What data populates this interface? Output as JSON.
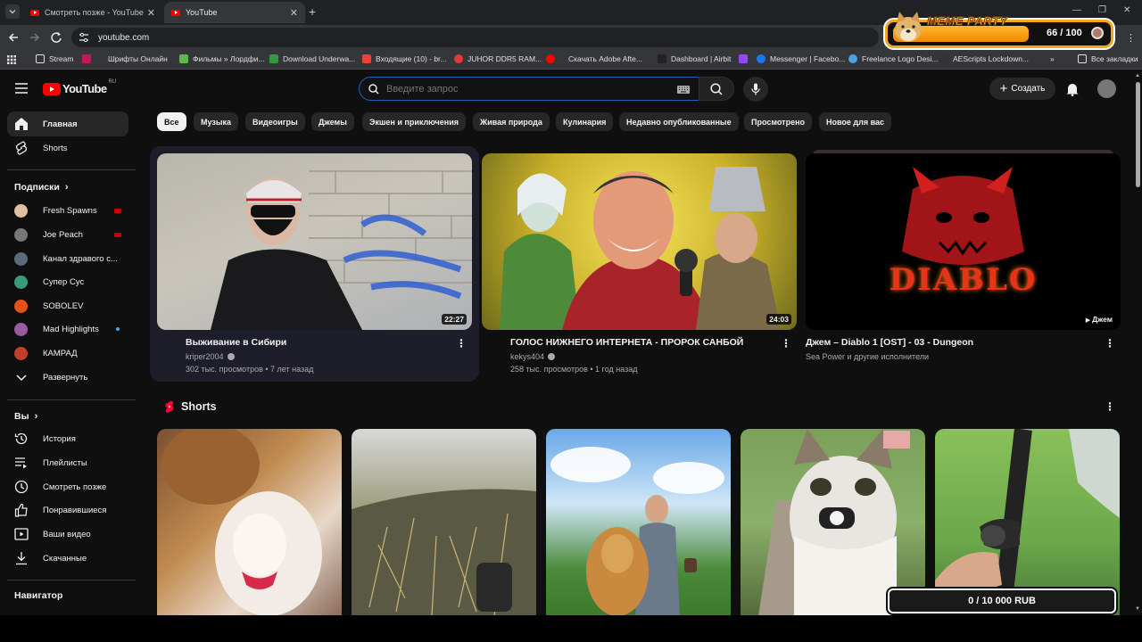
{
  "browser": {
    "tabs": [
      {
        "label": "Смотреть позже - YouTube",
        "active": false
      },
      {
        "label": "YouTube",
        "active": true
      }
    ],
    "address": "youtube.com",
    "bookmarks": [
      {
        "label": "Stream",
        "color": "#8ab4f8"
      },
      {
        "label": "Шрифты Онлайн",
        "color": "#e05a5a"
      },
      {
        "label": "Фильмы » Лордфи...",
        "color": "#59b94a"
      },
      {
        "label": "Download Underwa...",
        "color": "#2e9b3c"
      },
      {
        "label": "Входящие (10) - br...",
        "color": "#ea4335"
      },
      {
        "label": "JUHOR DDR5 RAM...",
        "color": "#e53935"
      },
      {
        "label": "Скачать Adobe Afte...",
        "color": "#ff0000"
      },
      {
        "label": "Dashboard | Airbit",
        "color": "#222222"
      },
      {
        "label": "Messenger | Facebo...",
        "color": "#1877f2"
      },
      {
        "label": "Freelance Logo Desi...",
        "color": "#4aa3df"
      },
      {
        "label": "AEScripts Lockdown...",
        "color": "#333333"
      }
    ],
    "all_bookmarks": "Все закладки"
  },
  "meme_overlay": {
    "title": "MEME PARTY",
    "count": "66 / 100"
  },
  "donation_overlay": {
    "text": "0 / 10 000 RUB"
  },
  "header": {
    "logo": "YouTube",
    "region": "RU",
    "search_placeholder": "Введите запрос",
    "create_label": "Создать"
  },
  "sidebar": {
    "main": [
      {
        "label": "Главная",
        "icon": "home-icon",
        "active": true
      },
      {
        "label": "Shorts",
        "icon": "shorts-icon",
        "active": false
      }
    ],
    "subscriptions_title": "Подписки",
    "subscriptions": [
      {
        "label": "Fresh Spawns",
        "avatar_color": "#e0c0a0",
        "badge": "live"
      },
      {
        "label": "Joe Peach",
        "avatar_color": "#777777",
        "badge": "live"
      },
      {
        "label": "Канал здравого с...",
        "avatar_color": "#5a6a7a",
        "badge": ""
      },
      {
        "label": "Супер Сус",
        "avatar_color": "#3a9a7a",
        "badge": ""
      },
      {
        "label": "SOBOLEV",
        "avatar_color": "#e8501a",
        "badge": ""
      },
      {
        "label": "Mad Highlights",
        "avatar_color": "#9a5aa0",
        "badge": "new"
      },
      {
        "label": "КАМРАД",
        "avatar_color": "#c0402a",
        "badge": ""
      }
    ],
    "expand_label": "Развернуть",
    "you_title": "Вы",
    "you_items": [
      {
        "label": "История",
        "icon": "history-icon"
      },
      {
        "label": "Плейлисты",
        "icon": "playlists-icon"
      },
      {
        "label": "Смотреть позже",
        "icon": "watch-later-icon"
      },
      {
        "label": "Понравившиеся",
        "icon": "like-icon"
      },
      {
        "label": "Ваши видео",
        "icon": "your-videos-icon"
      },
      {
        "label": "Скачанные",
        "icon": "downloads-icon"
      }
    ],
    "navigator_title": "Навигатор"
  },
  "chips": [
    "Все",
    "Музыка",
    "Видеоигры",
    "Джемы",
    "Экшен и приключения",
    "Живая природа",
    "Кулинария",
    "Недавно опубликованные",
    "Просмотрено",
    "Новое для вас"
  ],
  "videos": [
    {
      "title": "Выживание в Сибири",
      "channel": "kriper2004",
      "meta": "302 тыс. просмотров • 7 лет назад",
      "duration": "22:27"
    },
    {
      "title": "ГОЛОС НИЖНЕГО ИНТЕРНЕТА - ПРОРОК САНБОЙ",
      "channel": "kekys404",
      "meta": "258 тыс. просмотров • 1 год назад",
      "duration": "24:03"
    },
    {
      "title": "Джем – Diablo 1 [OST] - 03 - Dungeon",
      "channel": "Sea Power и другие исполнители",
      "meta": "",
      "duration": "Джем",
      "thumb_text": "DIABLO"
    }
  ],
  "shorts_section": {
    "title": "Shorts"
  }
}
